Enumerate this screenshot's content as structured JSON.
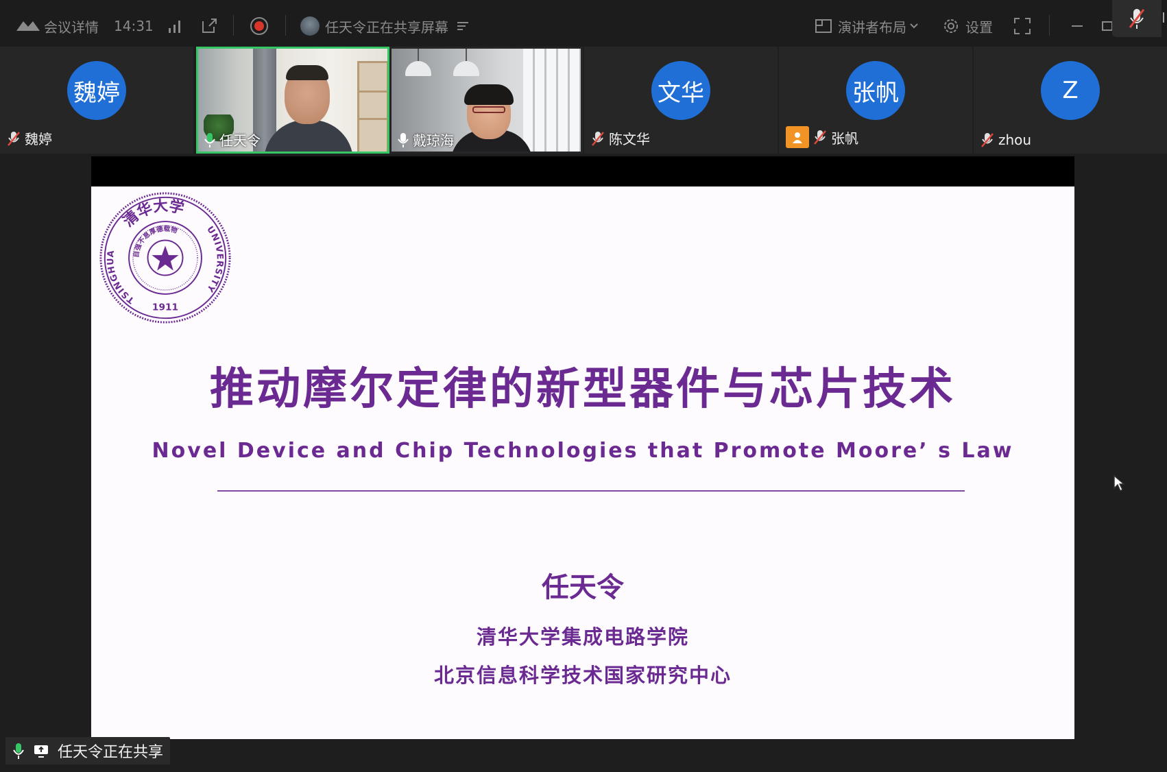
{
  "toolbar": {
    "meeting_details": "会议详情",
    "time": "14:31",
    "sharing_notice": "任天令正在共享屏幕",
    "layout_label": "演讲者布局",
    "settings_label": "设置",
    "corner_char": "I"
  },
  "participants": [
    {
      "avatar_text": "魏婷",
      "name": "魏婷"
    },
    {
      "name": "任天令"
    },
    {
      "name": "戴琼海"
    },
    {
      "avatar_text": "文华",
      "name": "陈文华"
    },
    {
      "avatar_text": "张帆",
      "name": "张帆"
    },
    {
      "avatar_text": "Z",
      "name": "zhou"
    }
  ],
  "slide": {
    "seal_top_text": "清华大学",
    "seal_left_text": "TSINGHUA",
    "seal_right_text": "UNIVERSITY",
    "seal_year": "1911",
    "seal_inner_text": "自强不息厚德载物",
    "title": "推动摩尔定律的新型器件与芯片技术",
    "subtitle": "Novel Device and Chip Technologies that Promote Moore’ s Law",
    "presenter": "任天令",
    "affiliation_1": "清华大学集成电路学院",
    "affiliation_2": "北京信息科学技术国家研究中心"
  },
  "status": {
    "sharing_label": "任天令正在共享"
  },
  "colors": {
    "slide_purple": "#6b2a92",
    "avatar_blue": "#1f6fd6",
    "speaking_green": "#35c766",
    "record_red": "#d8362a",
    "muted_red": "#e0483c"
  }
}
